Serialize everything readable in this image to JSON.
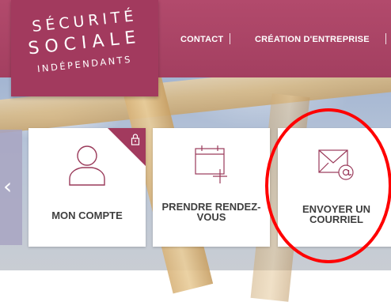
{
  "logo": {
    "line1": "SÉCURITÉ",
    "line2": "SOCIALE",
    "line3": "INDÉPENDANTS"
  },
  "nav": {
    "contact": "CONTACT",
    "creation": "CRÉATION D'ENTREPRISE"
  },
  "cards": [
    {
      "label": "MON COMPTE",
      "icon": "user-icon",
      "badge_icon": "lock-icon"
    },
    {
      "label": "PRENDRE RENDEZ-VOUS",
      "line1": "PRENDRE RENDEZ-",
      "line2": "VOUS",
      "icon": "calendar-add-icon"
    },
    {
      "label": "ENVOYER UN COURRIEL",
      "line1": "ENVOYER UN",
      "line2": "COURRIEL",
      "icon": "email-icon"
    }
  ],
  "colors": {
    "brand": "#a23a5e",
    "highlight": "#ff0000",
    "card_text": "#3f3f3f"
  }
}
